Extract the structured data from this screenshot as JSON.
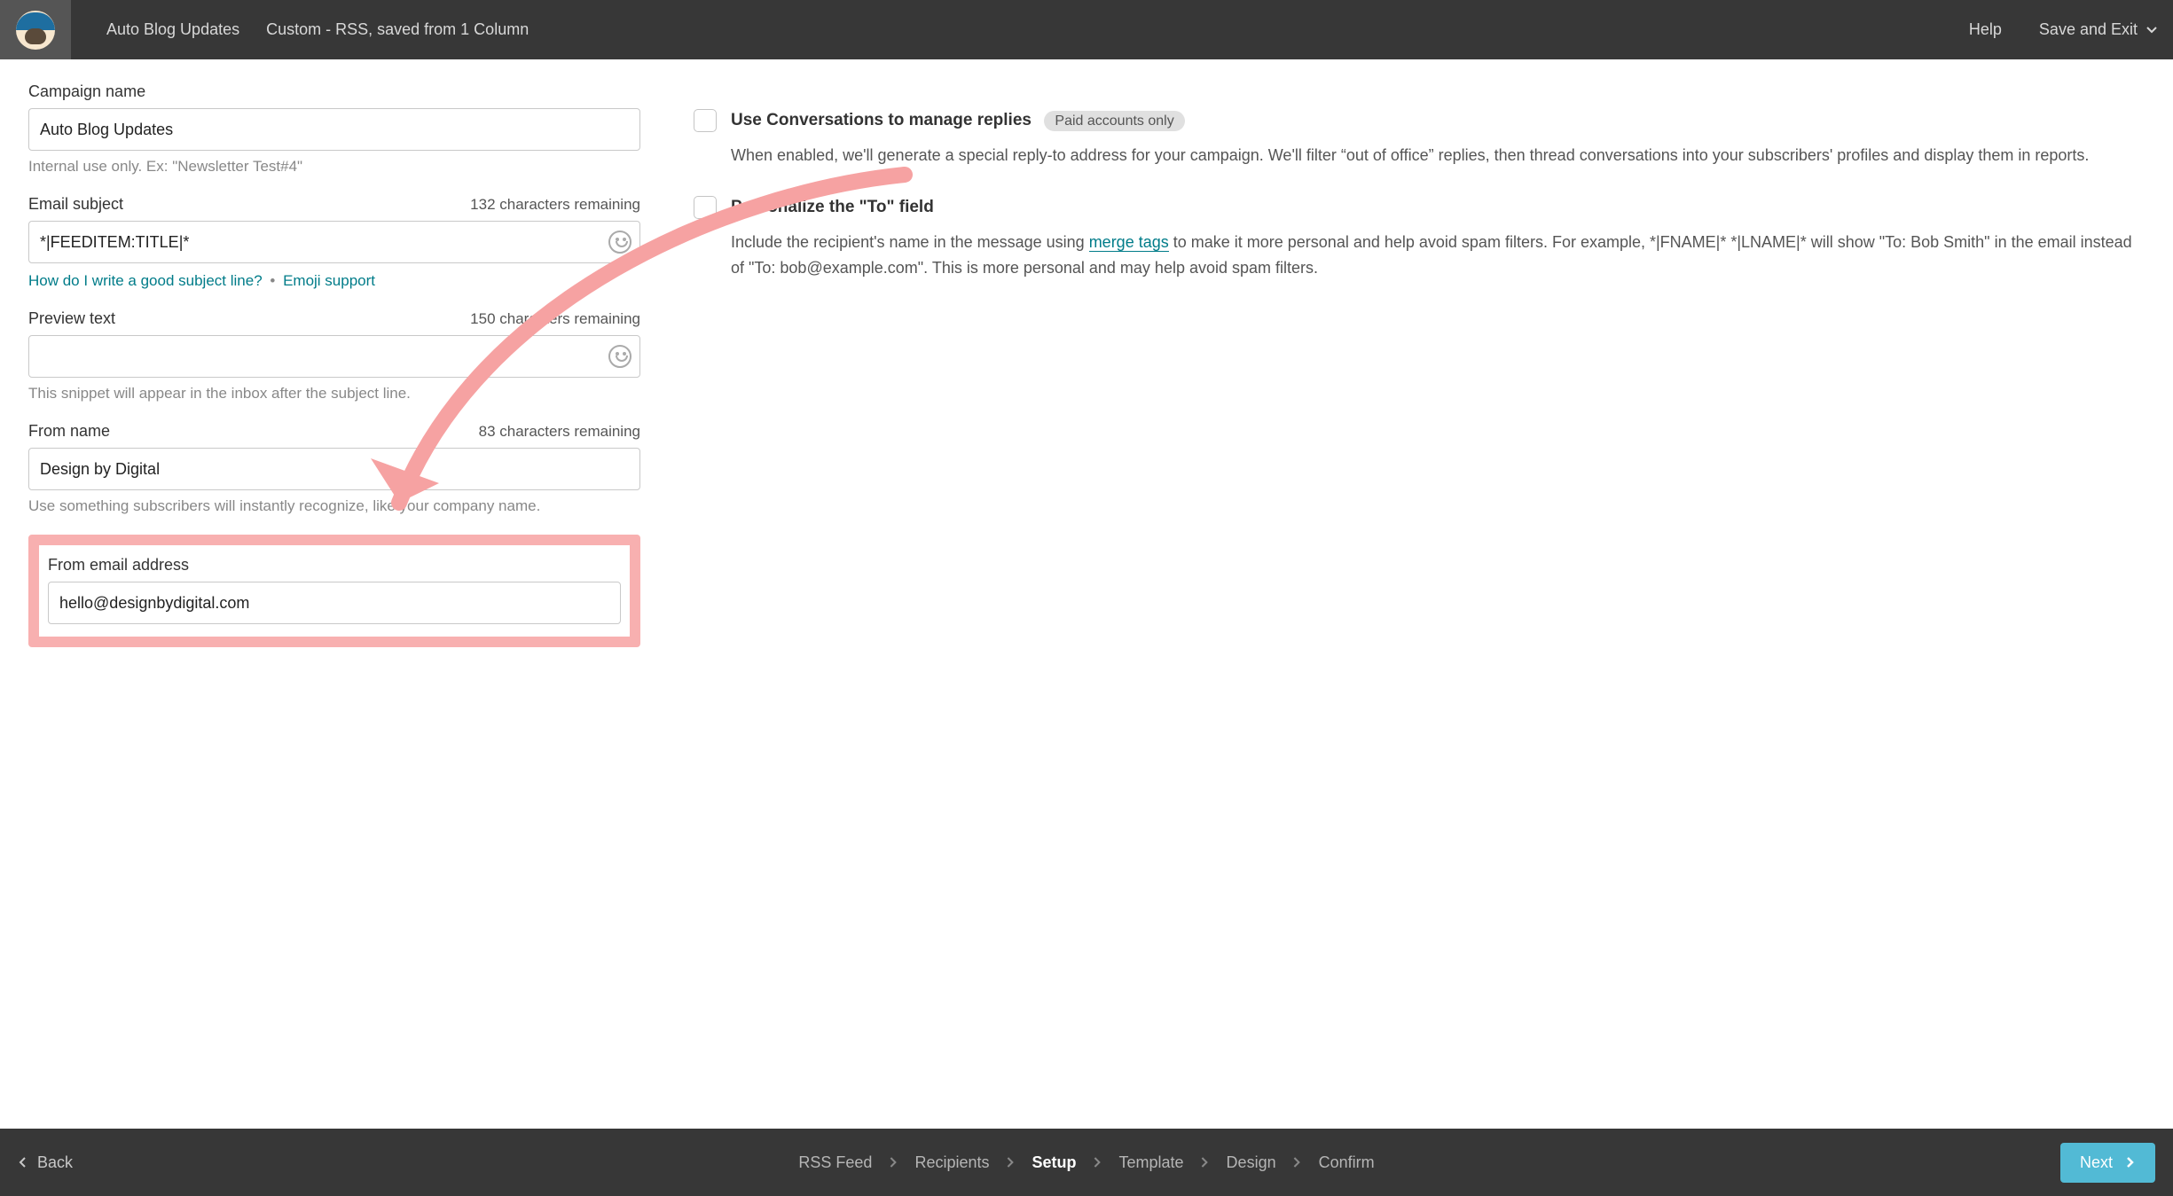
{
  "topbar": {
    "campaign_title": "Auto Blog Updates",
    "template_label": "Custom - RSS, saved from 1 Column",
    "help": "Help",
    "save_exit": "Save and Exit"
  },
  "fields": {
    "campaign_name": {
      "label": "Campaign name",
      "value": "Auto Blog Updates",
      "helper": "Internal use only. Ex: \"Newsletter Test#4\""
    },
    "email_subject": {
      "label": "Email subject",
      "remaining": "132 characters remaining",
      "value": "*|FEEDITEM:TITLE|*",
      "link1": "How do I write a good subject line?",
      "link2": "Emoji support"
    },
    "preview_text": {
      "label": "Preview text",
      "remaining": "150 characters remaining",
      "value": "",
      "helper": "This snippet will appear in the inbox after the subject line."
    },
    "from_name": {
      "label": "From name",
      "remaining": "83 characters remaining",
      "value": "Design by Digital",
      "helper": "Use something subscribers will instantly recognize, like your company name."
    },
    "from_email": {
      "label": "From email address",
      "value": "hello@designbydigital.com"
    }
  },
  "options": {
    "conversations": {
      "title": "Use Conversations to manage replies",
      "badge": "Paid accounts only",
      "desc": "When enabled, we'll generate a special reply-to address for your campaign. We'll filter “out of office” replies, then thread conversations into your subscribers' profiles and display them in reports."
    },
    "personalize": {
      "title": "Personalize the \"To\" field",
      "desc_pre": "Include the recipient's name in the message using ",
      "link": "merge tags",
      "desc_post": " to make it more personal and help avoid spam filters. For example, *|FNAME|* *|LNAME|* will show \"To: Bob Smith\" in the email instead of \"To: bob@example.com\". This is more personal and may help avoid spam filters."
    }
  },
  "bottombar": {
    "back": "Back",
    "steps": [
      "RSS Feed",
      "Recipients",
      "Setup",
      "Template",
      "Design",
      "Confirm"
    ],
    "active_step_index": 2,
    "next": "Next"
  }
}
